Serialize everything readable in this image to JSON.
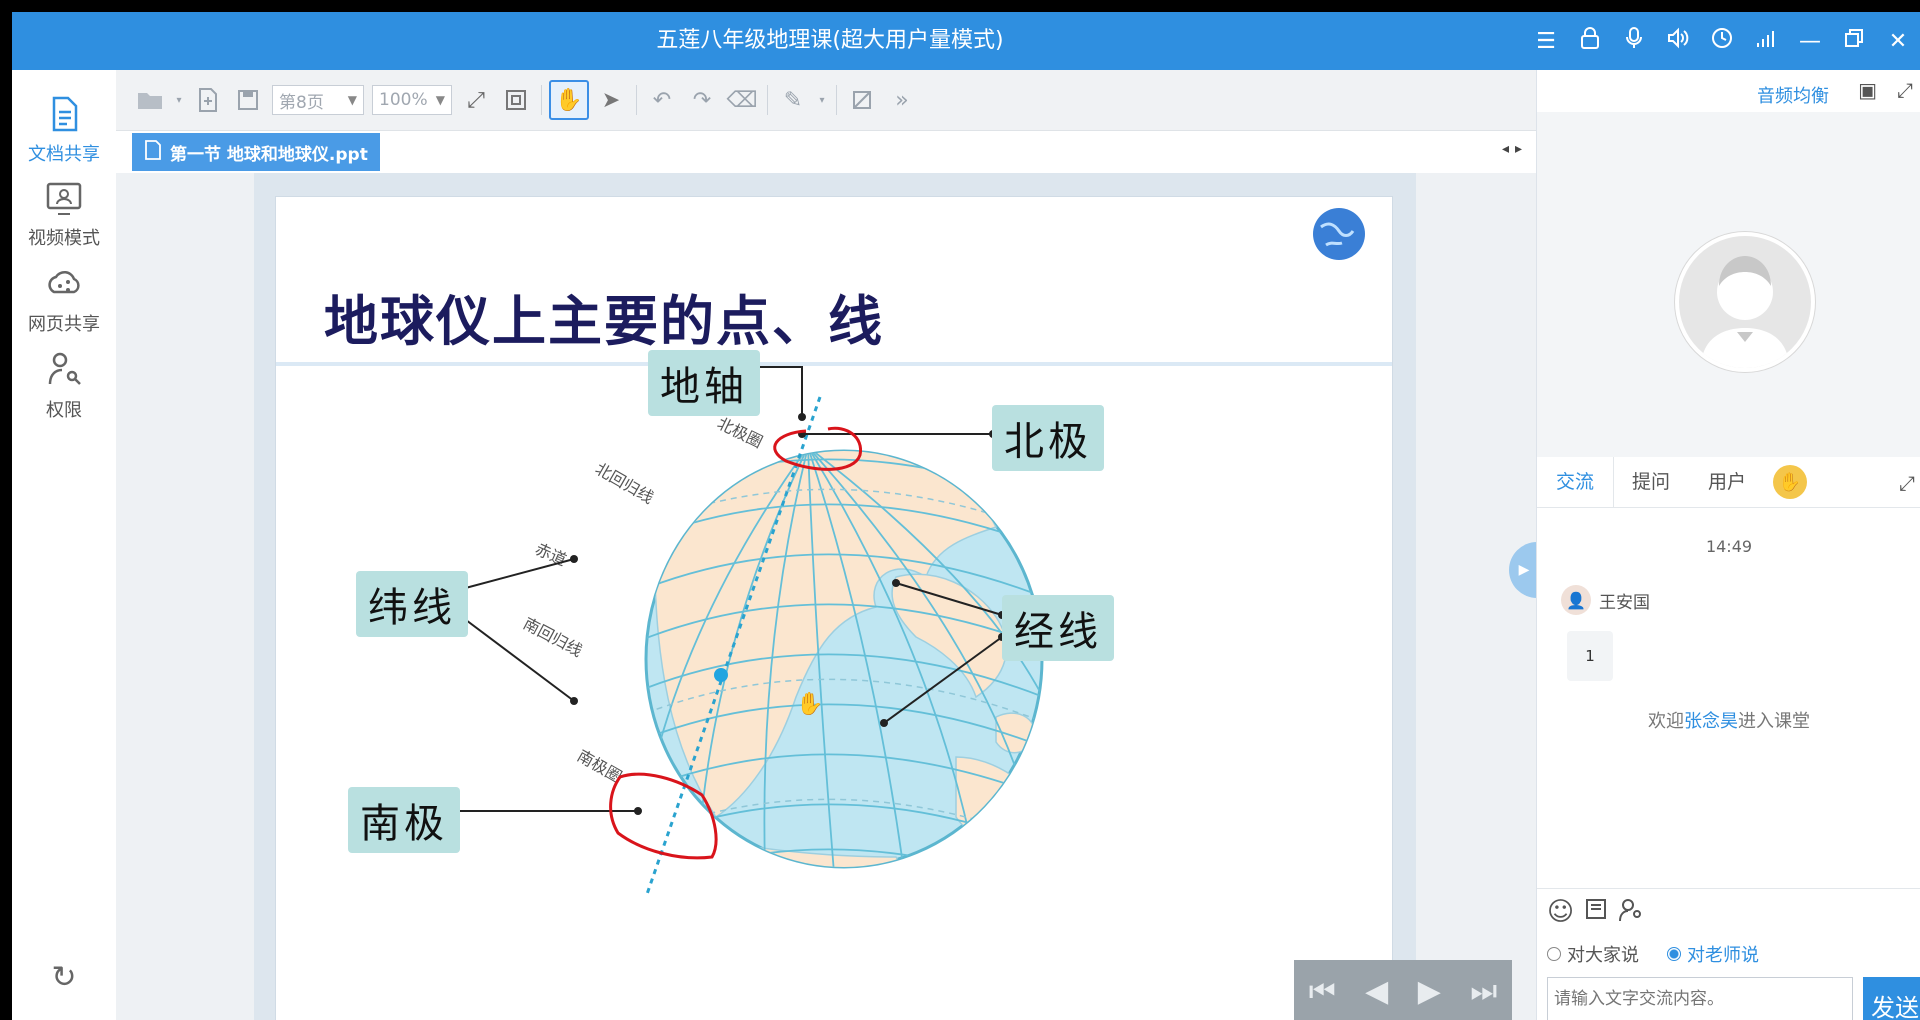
{
  "window": {
    "title": "五莲八年级地理课(超大用户量模式)",
    "controls": [
      "menu-icon",
      "lock-icon",
      "mic-icon",
      "speaker-icon",
      "clock-icon",
      "signal-icon",
      "minimize-icon",
      "restore-icon",
      "close-icon"
    ]
  },
  "sidebar": {
    "items": [
      {
        "label": "文档共享",
        "icon": "document-icon",
        "active": true
      },
      {
        "label": "视频模式",
        "icon": "video-icon",
        "active": false
      },
      {
        "label": "网页共享",
        "icon": "cloud-share-icon",
        "active": false
      },
      {
        "label": "权限",
        "icon": "user-key-icon",
        "active": false
      }
    ],
    "bottom_icon": "refresh-icon"
  },
  "toolbar": {
    "page_value": "第8页",
    "zoom_value": "100%"
  },
  "document": {
    "tab_label": "第一节  地球和地球仪.ppt"
  },
  "slide": {
    "title": "地球仪上主要的点、线",
    "labels": {
      "axis": "地轴",
      "north_pole": "北极",
      "latitude": "纬线",
      "longitude": "经线",
      "south_pole": "南极"
    },
    "globe_text": {
      "arctic_circle": "北极圈",
      "tropic_cancer": "北回归线",
      "equator": "赤道",
      "tropic_capricorn": "南回归线",
      "antarctic_circle": "南极圈"
    }
  },
  "right_panel": {
    "audio_balance": "音频均衡",
    "tabs": [
      {
        "label": "交流",
        "active": true
      },
      {
        "label": "提问",
        "active": false
      },
      {
        "label": "用户",
        "active": false
      }
    ],
    "chat": {
      "time": "14:49",
      "sender": "王安国",
      "message": "1",
      "welcome_prefix": "欢迎",
      "welcome_name": "张念昊",
      "welcome_suffix": "进入课堂"
    },
    "input": {
      "radio_all": "对大家说",
      "radio_teacher": "对老师说",
      "placeholder": "请输入文字交流内容。",
      "send_label": "发送"
    }
  },
  "colors": {
    "brand": "#2f8fe0",
    "annotation": "#d9141b",
    "label_bg": "#b9e0e0",
    "ocean": "#bfe6f2",
    "land": "#fbe6cf"
  }
}
